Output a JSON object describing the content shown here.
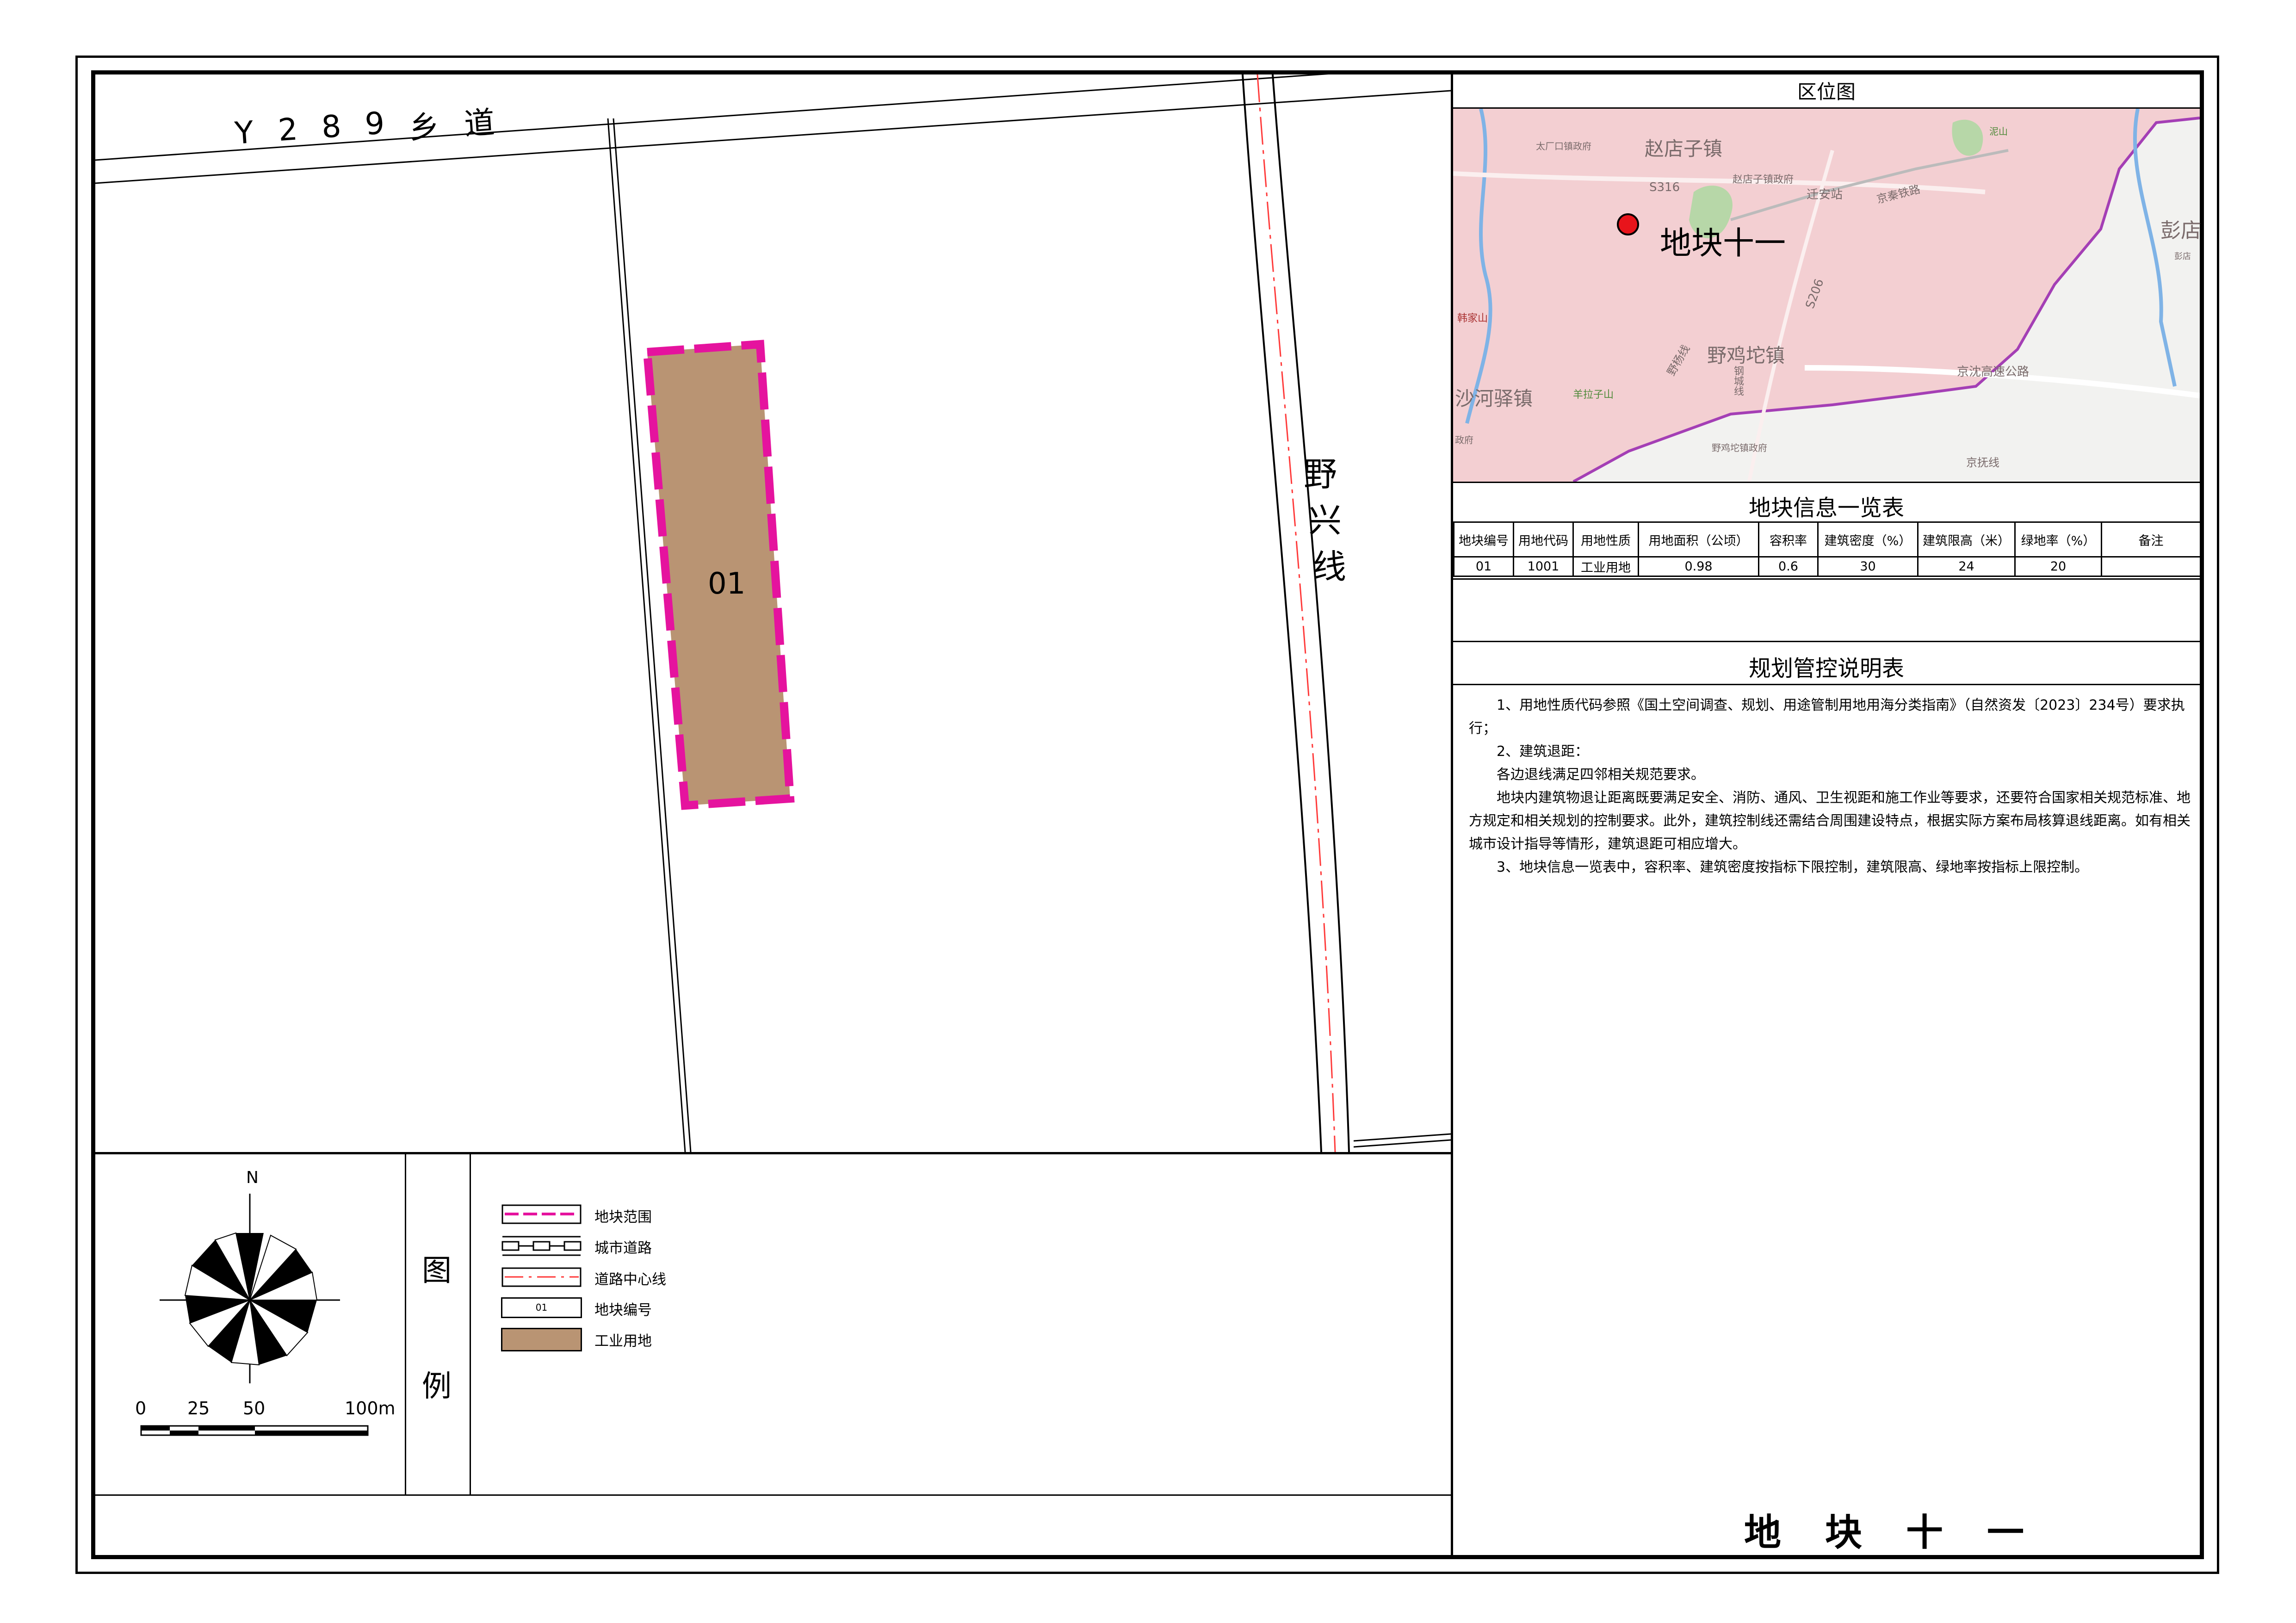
{
  "map": {
    "road_y289": "Y289乡道",
    "road_y289_chars": [
      "Y",
      "2",
      "8",
      "9",
      "乡",
      "道"
    ],
    "road_yexing_chars": [
      "野",
      "兴",
      "线"
    ],
    "parcel_label": "01",
    "colors": {
      "parcel_fill": "#b99473",
      "parcel_border": "#e5139e",
      "road_centerline": "#ff3a3a",
      "road_edge": "#000000"
    }
  },
  "location_map": {
    "title": "区位图",
    "marker_label": "地块十一",
    "labels": [
      "赵店子镇",
      "赵店子镇政府",
      "S316",
      "迁安站",
      "京秦铁路",
      "太厂口镇政府",
      "彭店",
      "彭店",
      "S206",
      "野鸡坨镇",
      "野杨线",
      "钢城线",
      "京沈高速公路",
      "沙河驿镇",
      "羊拉子山",
      "韩家山",
      "野鸡坨镇政府",
      "京抚线",
      "泥山",
      "政府"
    ],
    "colors": {
      "urban_fill": "#f3cfd2",
      "rural_fill": "#f2f2f0",
      "boundary": "#a43fb5",
      "marker": "#e8141b"
    }
  },
  "info_table": {
    "title": "地块信息一览表",
    "headers": [
      "地块编号",
      "用地代码",
      "用地性质",
      "用地面积（公顷）",
      "容积率",
      "建筑密度（%）",
      "建筑限高（米）",
      "绿地率（%）",
      "备注"
    ],
    "rows": [
      [
        "01",
        "1001",
        "工业用地",
        "0.98",
        "0.6",
        "30",
        "24",
        "20",
        ""
      ]
    ]
  },
  "control_notes": {
    "title": "规划管控说明表",
    "paragraphs": [
      "1、用地性质代码参照《国土空间调查、规划、用途管制用地用海分类指南》（自然资发〔2023〕234号）要求执行；",
      "2、建筑退距：",
      "各边退线满足四邻相关规范要求。",
      "地块内建筑物退让距离既要满足安全、消防、通风、卫生视距和施工作业等要求，还要符合国家相关规范标准、地方规定和相关规划的控制要求。此外，建筑控制线还需结合周围建设特点，根据实际方案布局核算退线距离。如有相关城市设计指导等情形，建筑退距可相应增大。",
      "3、地块信息一览表中，容积率、建筑密度按指标下限控制，建筑限高、绿地率按指标上限控制。"
    ]
  },
  "legend": {
    "title_chars": [
      "图",
      "例"
    ],
    "items": [
      {
        "icon": "parcel-boundary-symbol",
        "label": "地块范围"
      },
      {
        "icon": "city-road-symbol",
        "label": "城市道路"
      },
      {
        "icon": "road-centerline-symbol",
        "label": "道路中心线"
      },
      {
        "icon": "parcel-number-symbol",
        "label": "地块编号",
        "sample": "01"
      },
      {
        "icon": "industrial-land-swatch",
        "label": "工业用地"
      }
    ]
  },
  "compass": {
    "north": "N"
  },
  "scale_bar": {
    "ticks": [
      "0",
      "25",
      "50",
      "100m"
    ]
  },
  "sheet_title": "地块十一"
}
